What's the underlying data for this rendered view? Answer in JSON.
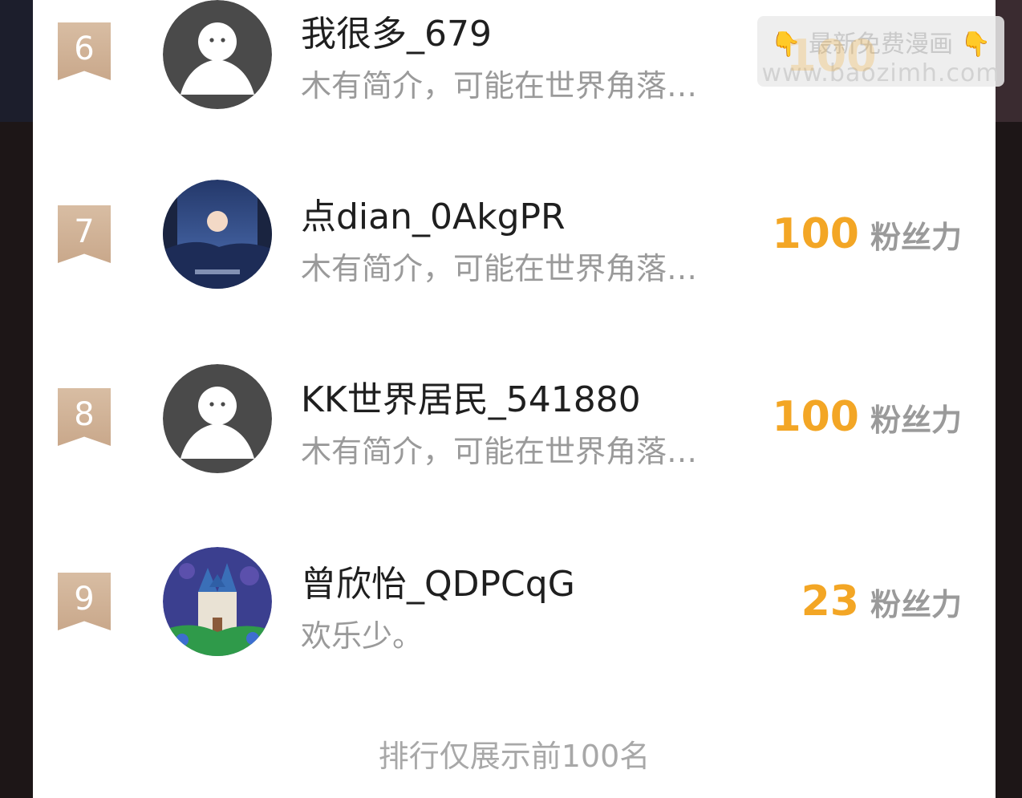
{
  "rows": [
    {
      "rank": "6",
      "name": "我很多_679",
      "bio": "木有简介，可能在世界角落…",
      "avatar": "default-avatar-icon"
    },
    {
      "rank": "7",
      "name": "点dian_0AkgPR",
      "bio": "木有简介，可能在世界角落…",
      "score": "100",
      "unit": "粉丝力",
      "avatar": "moon-photo"
    },
    {
      "rank": "8",
      "name": "KK世界居民_541880",
      "bio": "木有简介，可能在世界角落…",
      "score": "100",
      "unit": "粉丝力",
      "avatar": "default-avatar-icon"
    },
    {
      "rank": "9",
      "name": "曾欣怡_QDPCqG",
      "bio": "欢乐少。",
      "score": "23",
      "unit": "粉丝力",
      "avatar": "castle-illustration"
    }
  ],
  "watermark": {
    "line1": "最新免费漫画",
    "line2": "www.baozimh.com",
    "faded_score": "100",
    "hand_icon": "pointing-down-hand-icon"
  },
  "footer": "排行仅展示前100名",
  "colors": {
    "accent": "#f3a625",
    "rank_badge": "#d0b298",
    "muted": "#9a9a9a"
  }
}
